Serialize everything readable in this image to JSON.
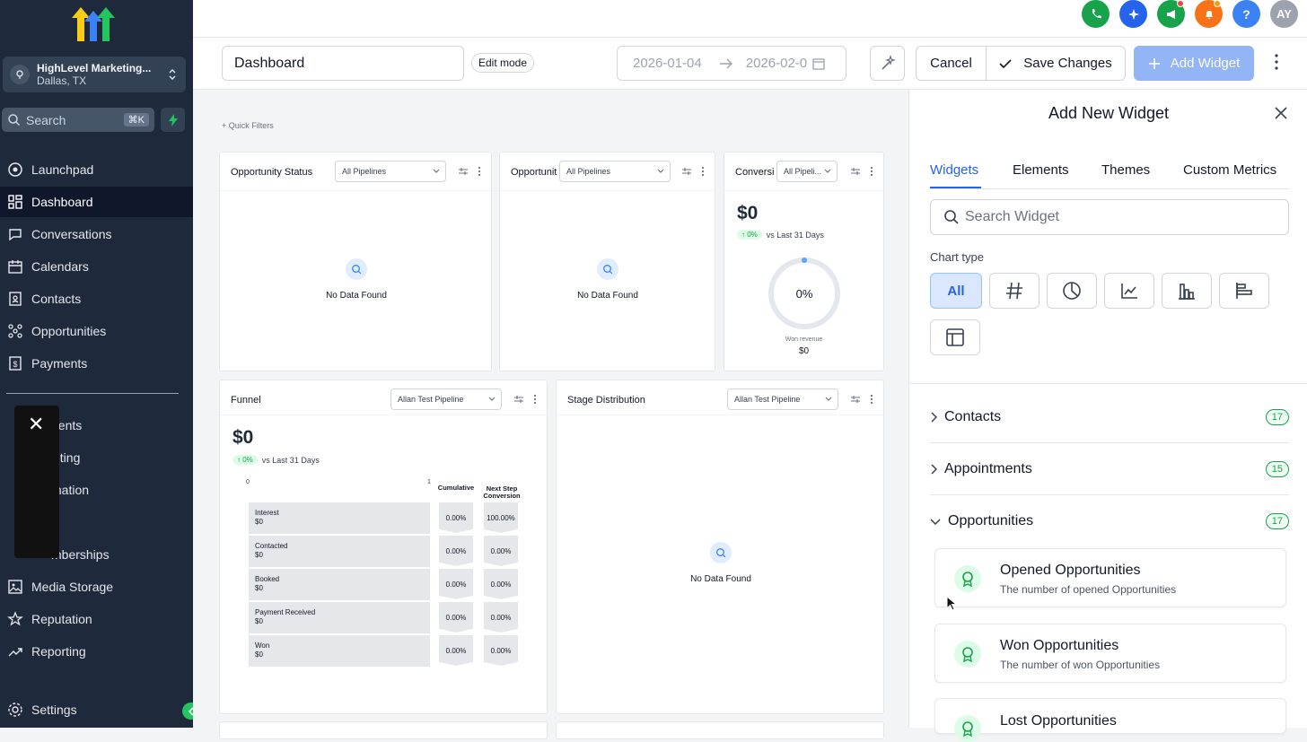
{
  "app": {
    "account_name": "HighLevel Marketing...",
    "account_location": "Dallas, TX",
    "search_placeholder": "Search",
    "search_shortcut": "⌘K",
    "user_initials": "AY"
  },
  "sidebar": {
    "items": [
      {
        "label": "Launchpad",
        "icon": "rocket-icon"
      },
      {
        "label": "Dashboard",
        "icon": "grid-icon",
        "active": true
      },
      {
        "label": "Conversations",
        "icon": "chat-icon"
      },
      {
        "label": "Calendars",
        "icon": "calendar-icon"
      },
      {
        "label": "Contacts",
        "icon": "contacts-icon"
      },
      {
        "label": "Opportunities",
        "icon": "opportunities-icon"
      },
      {
        "label": "Payments",
        "icon": "payments-icon"
      }
    ],
    "partial_items": [
      "gents",
      "eting",
      "mation",
      "",
      "mberships"
    ],
    "bottom_items": [
      {
        "label": "Media Storage",
        "icon": "image-icon"
      },
      {
        "label": "Reputation",
        "icon": "star-icon"
      },
      {
        "label": "Reporting",
        "icon": "trend-icon"
      }
    ],
    "settings_label": "Settings"
  },
  "header": {
    "dashboard_name": "Dashboard",
    "edit_mode_label": "Edit mode",
    "date_start": "2026-01-04",
    "date_end": "2026-02-0",
    "cancel_label": "Cancel",
    "save_label": "Save Changes",
    "add_widget_label": "Add Widget"
  },
  "canvas": {
    "quick_filters_label": "Quick Filters",
    "no_data": "No Data Found",
    "widgets": {
      "opp_status": {
        "title": "Opportunity Status",
        "select": "All Pipelines"
      },
      "opp_value": {
        "title": "Opportunit",
        "select": "All Pipelines"
      },
      "conversion": {
        "title": "Conversic",
        "select": "All Pipeli...",
        "value": "$0",
        "change": "0%",
        "compare": "vs Last 31 Days",
        "gauge": "0%",
        "gauge_percent": 0,
        "caption": "Won revenue",
        "caption_value": "$0"
      },
      "funnel": {
        "title": "Funnel",
        "select": "Allan Test Pipeline",
        "value": "$0",
        "change": "0%",
        "compare": "vs Last 31 Days",
        "axis_min": "0",
        "axis_max": "1",
        "col_cumulative": "Cumulative",
        "col_next": "Next Step Conversion",
        "stages": [
          {
            "name": "Interest",
            "value": "$0",
            "cumulative": "0.00%",
            "next": "100.00%"
          },
          {
            "name": "Contacted",
            "value": "$0",
            "cumulative": "0.00%",
            "next": "0.00%"
          },
          {
            "name": "Booked",
            "value": "$0",
            "cumulative": "0.00%",
            "next": "0.00%"
          },
          {
            "name": "Payment Received",
            "value": "$0",
            "cumulative": "0.00%",
            "next": "0.00%"
          },
          {
            "name": "Won",
            "value": "$0",
            "cumulative": "0.00%",
            "next": "0.00%"
          }
        ]
      },
      "stage_dist": {
        "title": "Stage Distribution",
        "select": "Allan Test Pipeline"
      }
    }
  },
  "panel": {
    "title": "Add New Widget",
    "tabs": [
      "Widgets",
      "Elements",
      "Themes",
      "Custom Metrics"
    ],
    "search_placeholder": "Search Widget",
    "chart_type_label": "Chart type",
    "chart_type_all": "All",
    "categories": [
      {
        "name": "Contacts",
        "count": "17"
      },
      {
        "name": "Appointments",
        "count": "15"
      },
      {
        "name": "Opportunities",
        "count": "17"
      }
    ],
    "widgets": [
      {
        "title": "Opened Opportunities",
        "desc": "The number of opened Opportunities"
      },
      {
        "title": "Won Opportunities",
        "desc": "The number of won Opportunities"
      },
      {
        "title": "Lost Opportunities",
        "desc": ""
      }
    ]
  },
  "colors": {
    "brand_blue": "#2563eb",
    "sidebar": "#1e293b",
    "success": "#16a34a"
  }
}
